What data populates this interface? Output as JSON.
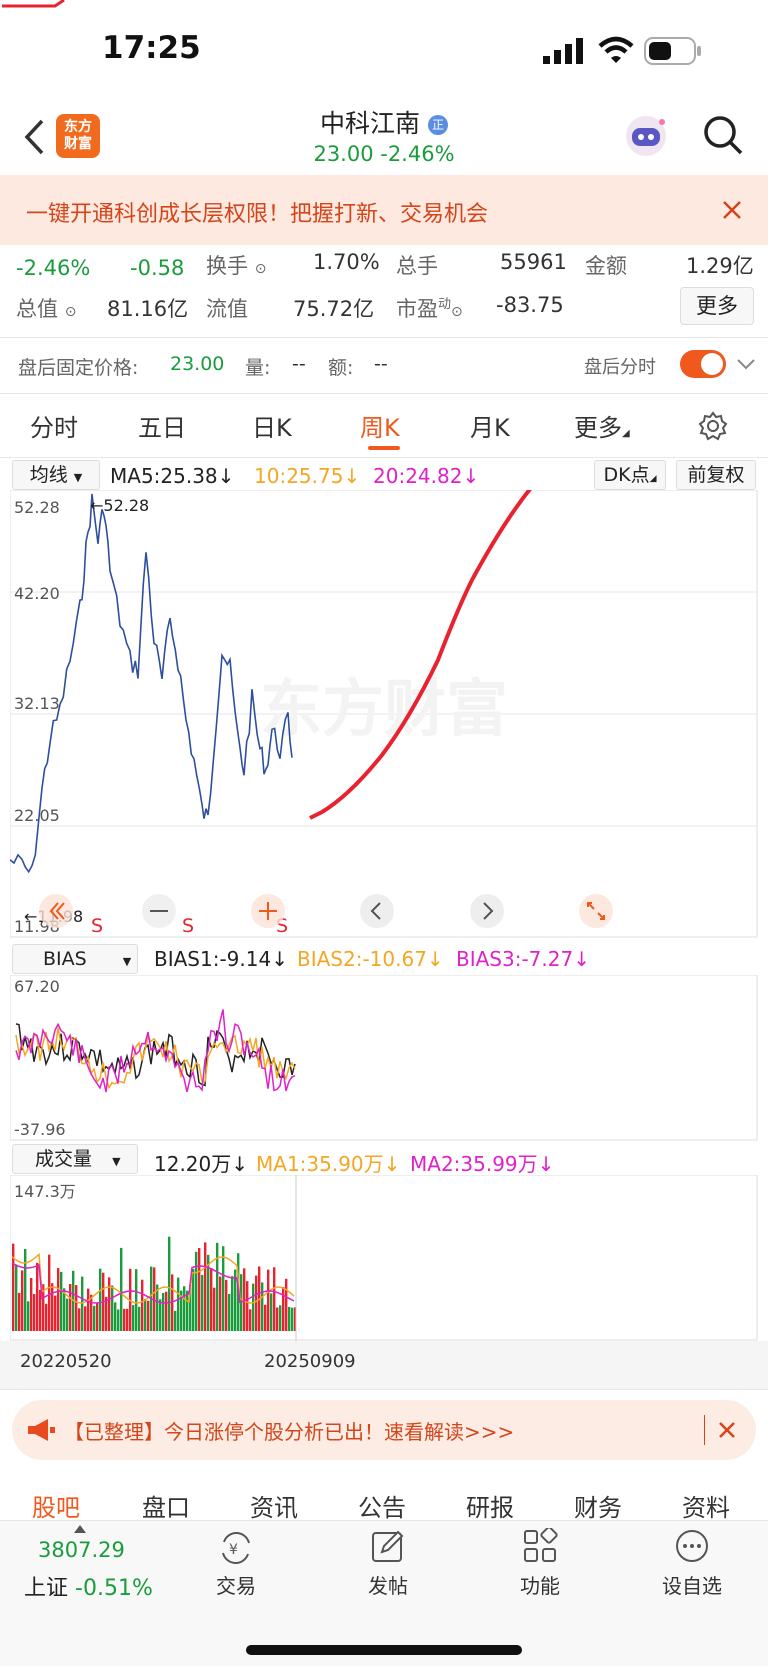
{
  "status_bar": {
    "time": "17:25"
  },
  "header": {
    "logo_text_1": "东方",
    "logo_text_2": "财富",
    "stock_name": "中科江南",
    "stock_badge": "正",
    "price_change": "23.00  -2.46%"
  },
  "banner": {
    "text": "一键开通科创成长层权限！把握打新、交易机会"
  },
  "quote": {
    "pct": "-2.46%",
    "chg": "-0.58",
    "turnover_label": "换手",
    "turnover": "1.70%",
    "volume_label": "总手",
    "volume": "55961",
    "amount_label": "金额",
    "amount": "1.29亿",
    "mcap_label": "总值",
    "mcap": "81.16亿",
    "float_label": "流值",
    "float_cap": "75.72亿",
    "pe_label": "市盈",
    "pe_sup": "动",
    "pe": "-83.75",
    "more_label": "更多"
  },
  "after_hours": {
    "label": "盘后固定价格:",
    "price": "23.00",
    "vol_label": "量:",
    "vol": "--",
    "amt_label": "额:",
    "amt": "--",
    "toggle_label": "盘后分时"
  },
  "tabs": [
    "分时",
    "五日",
    "日K",
    "周K",
    "月K",
    "更多"
  ],
  "active_tab": "周K",
  "ma_bar": {
    "selector": "均线",
    "ma5": "MA5:25.38↓",
    "ma10": "10:25.75↓",
    "ma20": "20:24.82↓",
    "dk": "DK点",
    "adjust": "前复权"
  },
  "main_chart": {
    "y_labels": [
      "52.28",
      "42.20",
      "32.13",
      "22.05",
      "11.98"
    ],
    "max_marker": "←52.28",
    "min_marker": "←11.98",
    "watermark": "东方财富",
    "s_marks": [
      "S",
      "S",
      "S"
    ]
  },
  "bias_bar": {
    "selector": "BIAS",
    "bias1": "BIAS1:-9.14↓",
    "bias2": "BIAS2:-10.67↓",
    "bias3": "BIAS3:-7.27↓",
    "y_top": "67.20",
    "y_bottom": "-37.96"
  },
  "vol_bar": {
    "selector": "成交量",
    "vol": "12.20万↓",
    "ma1": "MA1:35.90万↓",
    "ma2": "MA2:35.99万↓",
    "y_top": "147.3万"
  },
  "x_axis": {
    "start": "20220520",
    "end": "20250909"
  },
  "notice": {
    "text": "【已整理】今日涨停个股分析已出！速看解读>>>"
  },
  "subtabs": [
    "股吧",
    "盘口",
    "资讯",
    "公告",
    "研报",
    "财务",
    "资料"
  ],
  "bottom_bar": {
    "index_value": "3807.29",
    "index_name": "上证",
    "index_pct": "-0.51%",
    "trade": "交易",
    "post": "发帖",
    "function": "功能",
    "watchlist": "设自选"
  },
  "colors": {
    "accent": "#f0591e",
    "down": "#1a9c3c",
    "up": "#e8232f",
    "line": "#2d4f9e",
    "ma10": "#f5a623",
    "ma20": "#e020c8"
  }
}
